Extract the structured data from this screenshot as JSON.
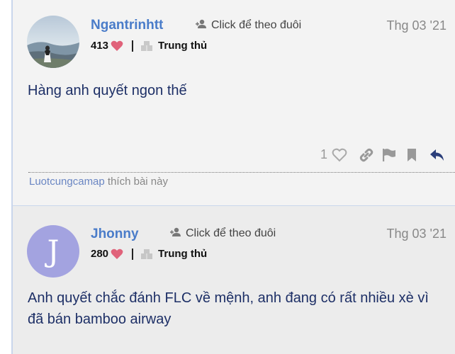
{
  "posts": [
    {
      "username": "Ngantrinhtt",
      "follow_label": "Click để theo đuôi",
      "date": "Thg 03 '21",
      "hearts": "413",
      "rank": "Trung thủ",
      "content": "Hàng anh quyết ngon thế",
      "like_count": "1",
      "liked_by_user": "Luotcungcamap",
      "liked_by_suffix": " thích bài này"
    },
    {
      "username": "Jhonny",
      "avatar_letter": "J",
      "follow_label": "Click để theo đuôi",
      "date": "Thg 03 '21",
      "hearts": "280",
      "rank": "Trung thủ",
      "content": "Anh quyết chắc đánh FLC về mệnh, anh đang có rất nhiều xè vì đã bán bamboo airway"
    }
  ],
  "colors": {
    "username": "#4a7cc9",
    "content": "#1d2f66",
    "heart": "#e0627a",
    "avatar_j": "#a3a3e0"
  }
}
